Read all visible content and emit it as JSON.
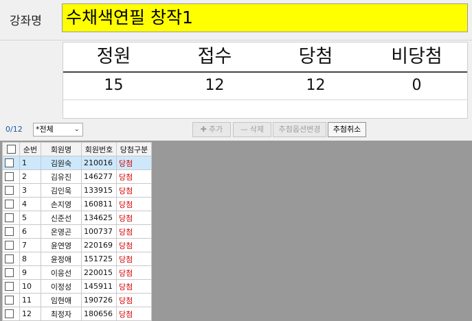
{
  "course": {
    "label": "강좌명",
    "name": "수채색연필 창작1"
  },
  "stats": {
    "headers": [
      "정원",
      "접수",
      "당첨",
      "비당첨"
    ],
    "values": [
      "15",
      "12",
      "12",
      "0"
    ]
  },
  "toolbar": {
    "count": "0/12",
    "filter": "*전체",
    "add_label": "추가",
    "delete_label": "삭제",
    "options_label": "추첨옵션변경",
    "cancel_label": "추첨취소"
  },
  "grid": {
    "columns": [
      "",
      "순번",
      "회원명",
      "회원번호",
      "당첨구분"
    ],
    "rows": [
      {
        "no": "1",
        "name": "김원숙",
        "id": "210016",
        "result": "당첨"
      },
      {
        "no": "2",
        "name": "김유진",
        "id": "146277",
        "result": "당첨"
      },
      {
        "no": "3",
        "name": "김인욱",
        "id": "133915",
        "result": "당첨"
      },
      {
        "no": "4",
        "name": "손지영",
        "id": "160811",
        "result": "당첨"
      },
      {
        "no": "5",
        "name": "신준선",
        "id": "134625",
        "result": "당첨"
      },
      {
        "no": "6",
        "name": "온영곤",
        "id": "100737",
        "result": "당첨"
      },
      {
        "no": "7",
        "name": "윤연영",
        "id": "220169",
        "result": "당첨"
      },
      {
        "no": "8",
        "name": "윤정애",
        "id": "151725",
        "result": "당첨"
      },
      {
        "no": "9",
        "name": "이응선",
        "id": "220015",
        "result": "당첨"
      },
      {
        "no": "10",
        "name": "이정성",
        "id": "145911",
        "result": "당첨"
      },
      {
        "no": "11",
        "name": "임현애",
        "id": "190726",
        "result": "당첨"
      },
      {
        "no": "12",
        "name": "최정자",
        "id": "180656",
        "result": "당첨"
      }
    ]
  }
}
